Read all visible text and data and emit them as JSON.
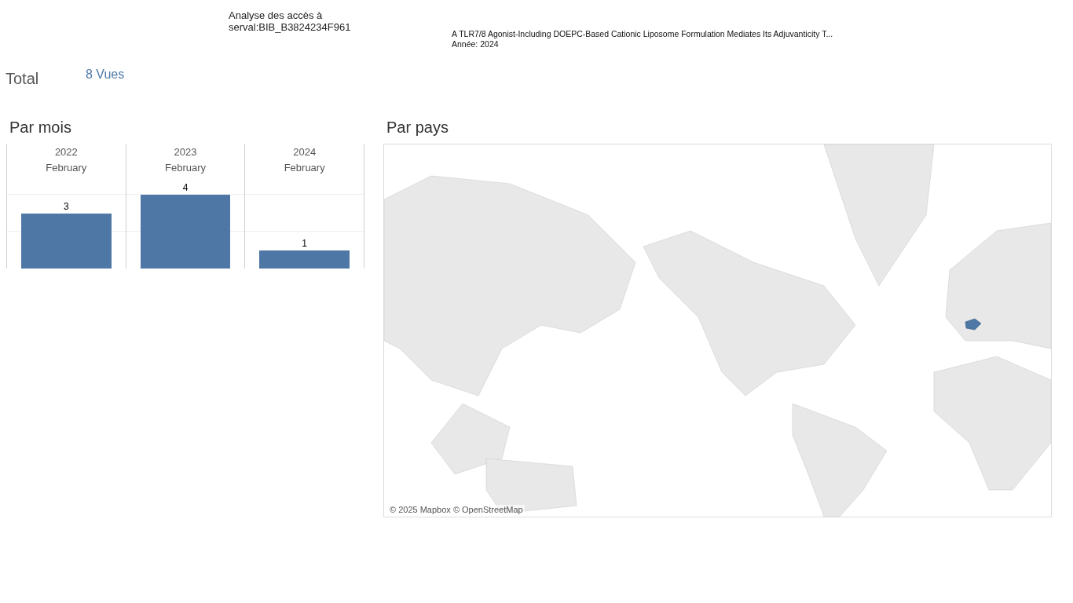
{
  "header": {
    "title_lines": [
      "Analyse des accès à",
      "serval:BIB_B3824234F961"
    ],
    "publication": "A TLR7/8 Agonist-Including DOEPC-Based Cationic Liposome Formulation Mediates Its Adjuvanticity T...",
    "year": "Année: 2024"
  },
  "total": {
    "label": "Total",
    "value": "8 Vues"
  },
  "by_month": {
    "title": "Par mois",
    "months": [
      "February",
      "February",
      "February"
    ],
    "chart_data": {
      "type": "bar",
      "categories": [
        "2022",
        "2023",
        "2024"
      ],
      "values": [
        3,
        4,
        1
      ],
      "ylim": [
        0,
        4
      ],
      "data_labels": true
    }
  },
  "by_country": {
    "title": "Par pays",
    "attribution": "© 2025 Mapbox © OpenStreetMap"
  }
}
